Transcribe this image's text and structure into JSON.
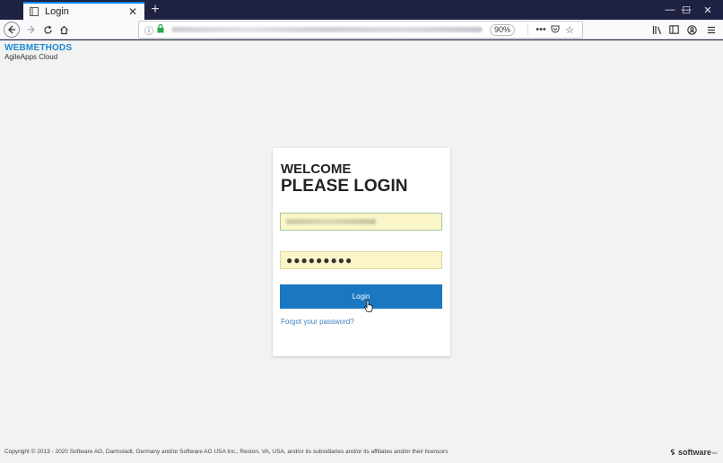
{
  "browser": {
    "tab_title": "Login",
    "new_tab": "+",
    "zoom": "90%",
    "overflow": "•••",
    "window_controls": [
      "—",
      "☐",
      "✕"
    ]
  },
  "page": {
    "logo_main": "WEBMETHODS",
    "logo_sub": "AgileApps Cloud",
    "welcome": "WELCOME",
    "please_login": "PLEASE LOGIN",
    "password_value": "●●●●●●●●●",
    "login_label": "Login",
    "forgot_label": "Forgot your password?",
    "footer": "Copyright © 2013 - 2020 Software AG, Darmstadt, Germany and/or Software AG USA Inc., Reston, VA, USA, and/or its subsidiaries and/or its affiliates and/or their licensors",
    "brand": "software",
    "brand_suffix": "AG"
  },
  "colors": {
    "accent": "#1a78c2",
    "link": "#3a7fc4",
    "autofill": "#fbf6c9",
    "logo": "#1f8ad0"
  }
}
